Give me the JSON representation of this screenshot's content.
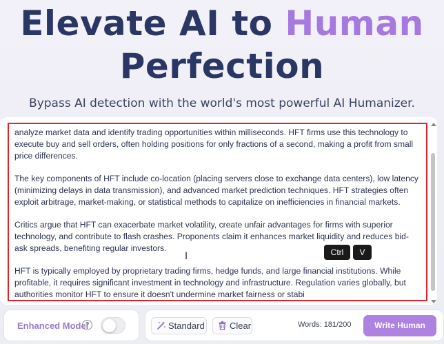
{
  "hero": {
    "line1_main": "Elevate AI to ",
    "line1_accent": "Human",
    "line2": "Perfection",
    "subtitle": "Bypass AI detection with the world's most powerful AI Humanizer."
  },
  "editor": {
    "paragraphs": [
      "analyze market data and identify trading opportunities within milliseconds. HFT firms use this technology to execute buy and sell orders, often holding positions for only fractions of a second, making a profit from small price differences.",
      "The key components of HFT include co-location (placing servers close to exchange data centers), low latency (minimizing delays in data transmission), and advanced market prediction techniques. HFT strategies often exploit arbitrage, market-making, or statistical methods to capitalize on inefficiencies in financial markets.",
      "Critics argue that HFT can exacerbate market volatility, create unfair advantages for firms with superior technology, and contribute to flash crashes. Proponents claim it enhances market liquidity and reduces bid-ask spreads, benefiting regular investors.",
      "HFT is typically employed by proprietary trading firms, hedge funds, and large financial institutions. While profitable, it requires significant investment in technology and infrastructure. Regulation varies globally, but authorities monitor HFT to ensure it doesn't undermine market fairness or stabi"
    ],
    "highlight_color": "#e0232a"
  },
  "keys": {
    "ctrl": "Ctrl",
    "v": "V"
  },
  "cursor_glyph": "I",
  "controls": {
    "enhanced_label": "Enhanced Model",
    "help_glyph": "?",
    "enhanced_on": false,
    "standard_label": "Standard",
    "clear_label": "Clear",
    "words_label": "Words: 181/200",
    "write_label": "Write Human"
  },
  "colors": {
    "title": "#2a3663",
    "accent": "#a679e0",
    "button": "#ae82e0"
  },
  "icons": {
    "standard": "magic-wand-icon",
    "clear": "trash-icon",
    "help": "help-circle-icon"
  }
}
